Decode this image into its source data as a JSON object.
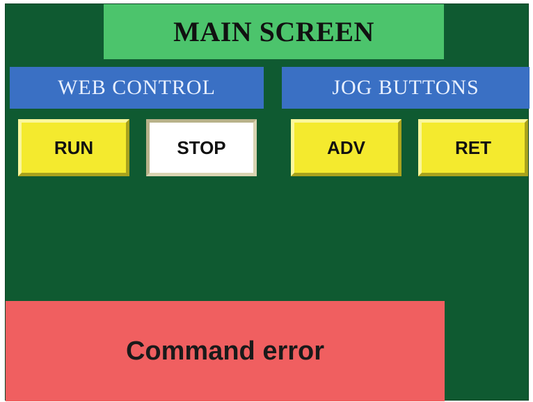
{
  "screen": {
    "title": "MAIN SCREEN",
    "background_color": "#0f5a31",
    "title_color": "#4cc46c"
  },
  "web_control": {
    "header": "WEB CONTROL",
    "buttons": {
      "run": "RUN",
      "stop": "STOP"
    }
  },
  "jog_buttons": {
    "header": "JOG BUTTONS",
    "buttons": {
      "adv": "ADV",
      "ret": "RET"
    }
  },
  "status": {
    "message": "Command error",
    "color": "#f05f60"
  },
  "colors": {
    "header_blue": "#3a70c4",
    "button_yellow": "#f4ea2e",
    "button_active_white": "#ffffff"
  }
}
